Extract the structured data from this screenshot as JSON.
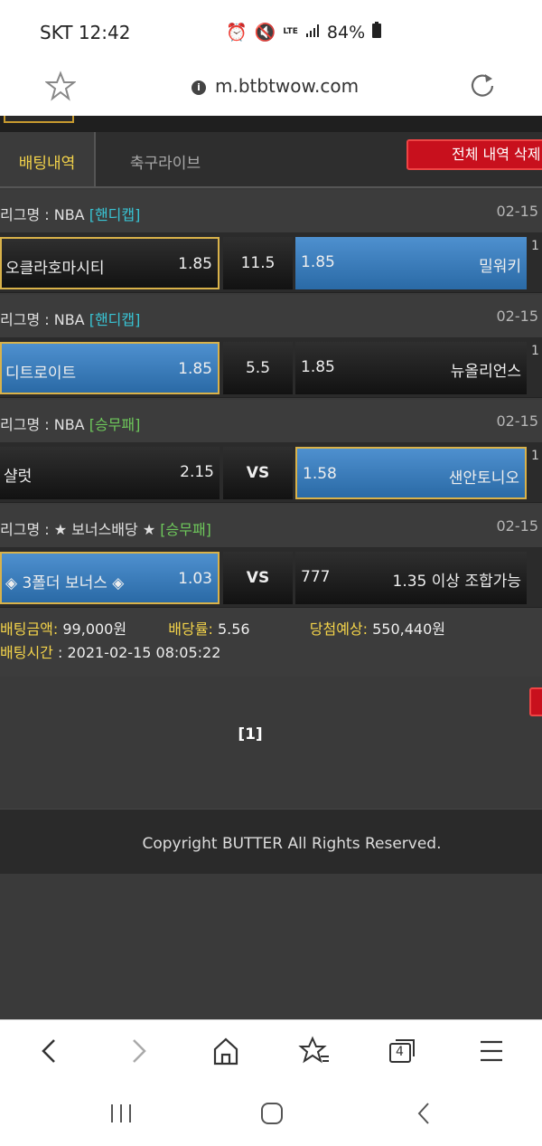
{
  "status_bar": {
    "carrier_time": "SKT 12:42",
    "lte": "LTE",
    "battery": "84%"
  },
  "browser": {
    "url": "m.btbtwow.com",
    "tab_count": "4"
  },
  "tabs": {
    "active": "배팅내역",
    "inactive": "축구라이브"
  },
  "delete_all_label": "전체 내역 삭제",
  "bets": [
    {
      "league_prefix": "리그명 : NBA ",
      "league_type": "[핸디캡]",
      "date": "02-15",
      "home": "오클라호마시티",
      "home_odds": "1.85",
      "mid": "11.5",
      "away_odds": "1.85",
      "away": "밀워키",
      "edge": "1"
    },
    {
      "league_prefix": "리그명 : NBA ",
      "league_type": "[핸디캡]",
      "date": "02-15",
      "home": "디트로이트",
      "home_odds": "1.85",
      "mid": "5.5",
      "away_odds": "1.85",
      "away": "뉴올리언스",
      "edge": "1"
    },
    {
      "league_prefix": "리그명 : NBA ",
      "league_type": "[승무패]",
      "date": "02-15",
      "home": "샬럿",
      "home_odds": "2.15",
      "mid": "VS",
      "away_odds": "1.58",
      "away": "샌안토니오",
      "edge": "1"
    },
    {
      "league_prefix": "리그명 : ★ 보너스배당 ★ ",
      "league_type": "[승무패]",
      "date": "02-15",
      "home": "◈ 3폴더 보너스 ◈",
      "home_odds": "1.03",
      "mid": "VS",
      "away_odds": "777",
      "away": "1.35 이상 조합가능",
      "edge": ""
    }
  ],
  "summary": {
    "bet_amount_label": "배팅금액:",
    "bet_amount": "99,000원",
    "odds_label": "배당률:",
    "odds": "5.56",
    "expected_label": "당첨예상:",
    "expected": "550,440원",
    "time_label": "배팅시간",
    "time": " : 2021-02-15 08:05:22"
  },
  "pagination": "[1]",
  "footer": "Copyright BUTTER All Rights Reserved.",
  "colors": {
    "accent_yellow": "#f3d34a",
    "selected_blue": "#3a7cbc",
    "delete_red": "#c8101d",
    "handicap_cyan": "#39c4d4",
    "wdl_green": "#6ec85b"
  }
}
